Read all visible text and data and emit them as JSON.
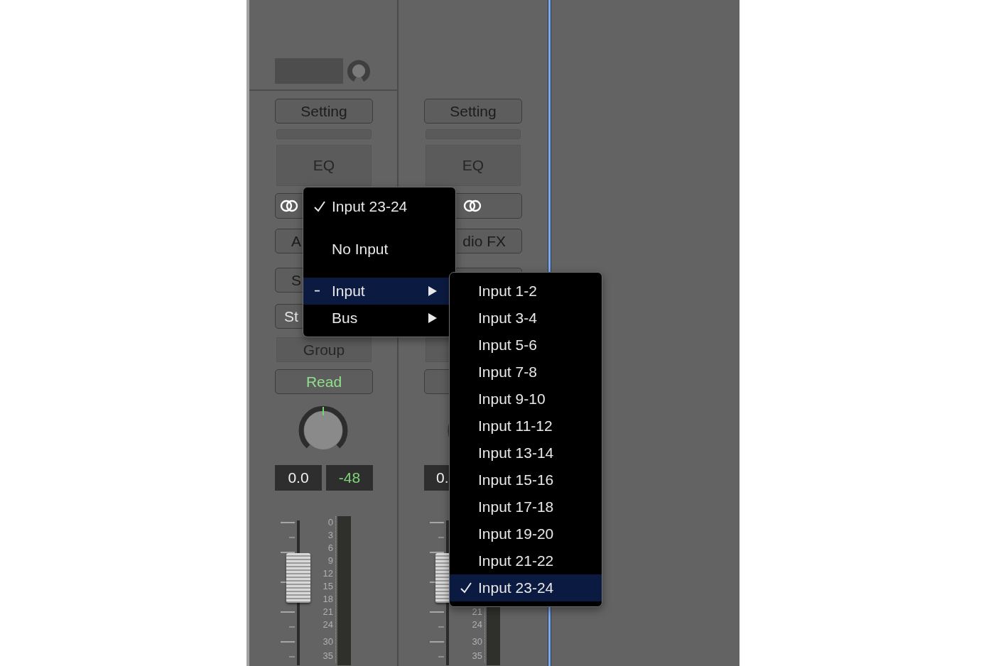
{
  "strips": [
    {
      "header": true,
      "setting": "Setting",
      "eq": "EQ",
      "audio_fx": "A",
      "sends": "S",
      "output": "St",
      "group": "Group",
      "automation": "Read",
      "volume": "0.0",
      "peak": "-48",
      "scale": [
        "0",
        "3",
        "6",
        "9",
        "12",
        "15",
        "18",
        "21",
        "24",
        "30",
        "35"
      ]
    },
    {
      "setting": "Setting",
      "eq": "EQ",
      "audio_fx": "dio FX",
      "volume": "0.",
      "scale": [
        "21",
        "24",
        "30",
        "35"
      ]
    }
  ],
  "input_menu": {
    "items": [
      {
        "label": "Input 23-24",
        "kind": "item",
        "checked": true,
        "mixed": false,
        "selected": false
      },
      {
        "label": "No Input",
        "kind": "item",
        "checked": false,
        "mixed": false,
        "selected": false
      },
      {
        "label": "Input",
        "kind": "submenu",
        "checked": false,
        "mixed": true,
        "selected": true
      },
      {
        "label": "Bus",
        "kind": "submenu",
        "checked": false,
        "mixed": false,
        "selected": false
      }
    ]
  },
  "input_submenu": {
    "items": [
      {
        "label": "Input 1-2",
        "checked": false,
        "selected": false
      },
      {
        "label": "Input 3-4",
        "checked": false,
        "selected": false
      },
      {
        "label": "Input 5-6",
        "checked": false,
        "selected": false
      },
      {
        "label": "Input 7-8",
        "checked": false,
        "selected": false
      },
      {
        "label": "Input 9-10",
        "checked": false,
        "selected": false
      },
      {
        "label": "Input 11-12",
        "checked": false,
        "selected": false
      },
      {
        "label": "Input 13-14",
        "checked": false,
        "selected": false
      },
      {
        "label": "Input 15-16",
        "checked": false,
        "selected": false
      },
      {
        "label": "Input 17-18",
        "checked": false,
        "selected": false
      },
      {
        "label": "Input 19-20",
        "checked": false,
        "selected": false
      },
      {
        "label": "Input 21-22",
        "checked": false,
        "selected": false
      },
      {
        "label": "Input 23-24",
        "checked": true,
        "selected": true
      }
    ]
  }
}
